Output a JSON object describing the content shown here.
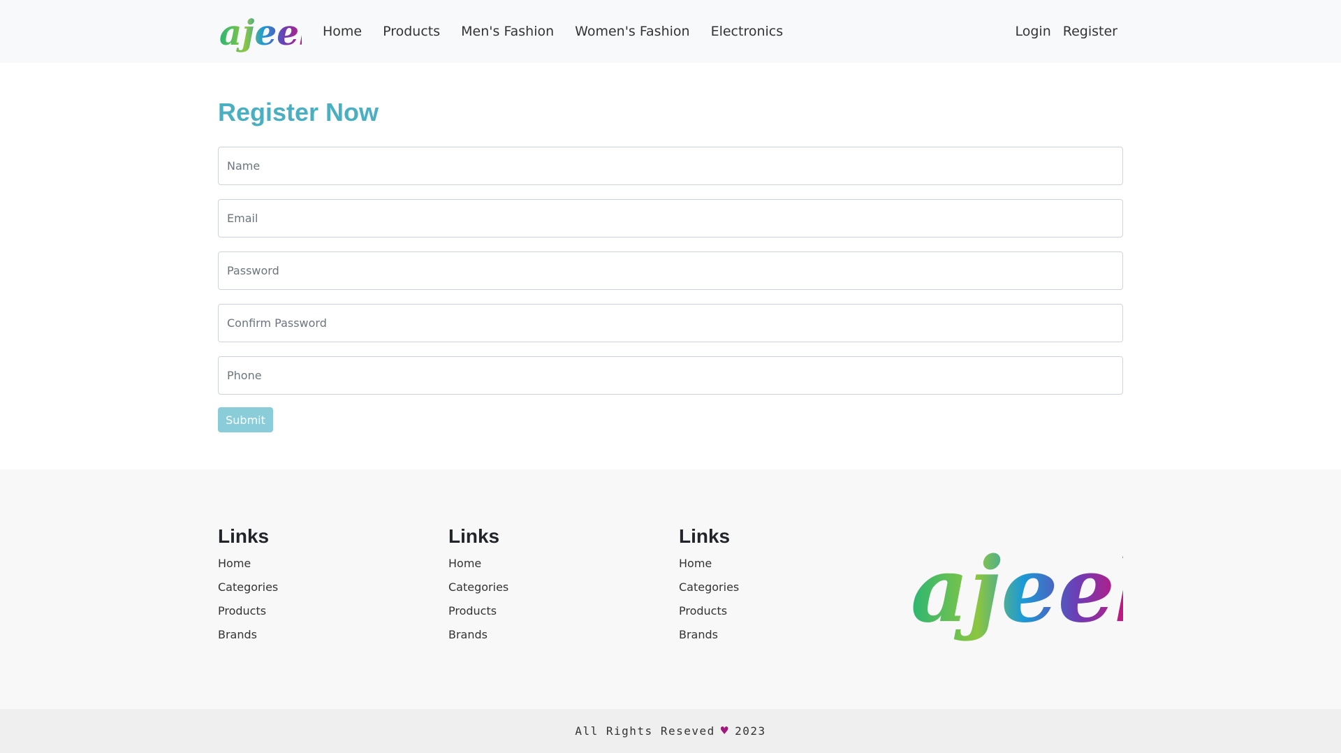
{
  "nav": {
    "logo_text": "ajeeb",
    "links": [
      "Home",
      "Products",
      "Men's Fashion",
      "Women's Fashion",
      "Electronics"
    ],
    "right_links": [
      "Login",
      "Register"
    ]
  },
  "main": {
    "title": "Register Now",
    "fields": [
      {
        "placeholder": "Name",
        "value": ""
      },
      {
        "placeholder": "Email",
        "value": ""
      },
      {
        "placeholder": "Password",
        "value": ""
      },
      {
        "placeholder": "Confirm Password",
        "value": ""
      },
      {
        "placeholder": "Phone",
        "value": ""
      }
    ],
    "submit_label": "Submit"
  },
  "footer": {
    "columns": [
      {
        "title": "Links",
        "items": [
          "Home",
          "Categories",
          "Products",
          "Brands"
        ]
      },
      {
        "title": "Links",
        "items": [
          "Home",
          "Categories",
          "Products",
          "Brands"
        ]
      },
      {
        "title": "Links",
        "items": [
          "Home",
          "Categories",
          "Products",
          "Brands"
        ]
      }
    ],
    "logo_text": "ajeeb"
  },
  "bottom": {
    "text_before": "All Rights Reseved",
    "icon": "heart-icon",
    "text_after": "2023"
  },
  "colors": {
    "accent": "#4ab0c1",
    "button": "#8acdd8",
    "heart": "#a0177a"
  }
}
